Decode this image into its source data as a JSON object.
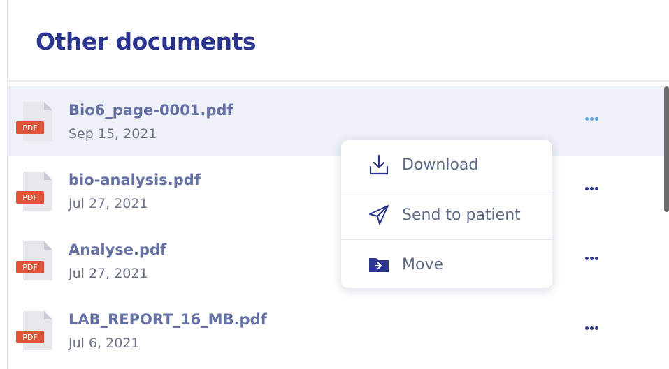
{
  "section": {
    "title": "Other documents"
  },
  "documents": [
    {
      "name": "Bio6_page-0001.pdf",
      "date": "Sep 15, 2021",
      "type_badge": "PDF",
      "selected": true
    },
    {
      "name": "bio-analysis.pdf",
      "date": "Jul 27, 2021",
      "type_badge": "PDF"
    },
    {
      "name": "Analyse.pdf",
      "date": "Jul 27, 2021",
      "type_badge": "PDF"
    },
    {
      "name": "LAB_REPORT_16_MB.pdf",
      "date": "Jul 6, 2021",
      "type_badge": "PDF"
    }
  ],
  "context_menu": {
    "items": [
      {
        "label": "Download",
        "icon": "download-icon"
      },
      {
        "label": "Send to patient",
        "icon": "send-icon"
      },
      {
        "label": "Move",
        "icon": "move-folder-icon"
      }
    ]
  },
  "colors": {
    "title": "#2b3590",
    "file_name": "#6570a3",
    "date": "#6e7488",
    "selected_row": "#eef1f7",
    "pdf_badge": "#e0553a",
    "more_active": "#5aa8e6"
  }
}
